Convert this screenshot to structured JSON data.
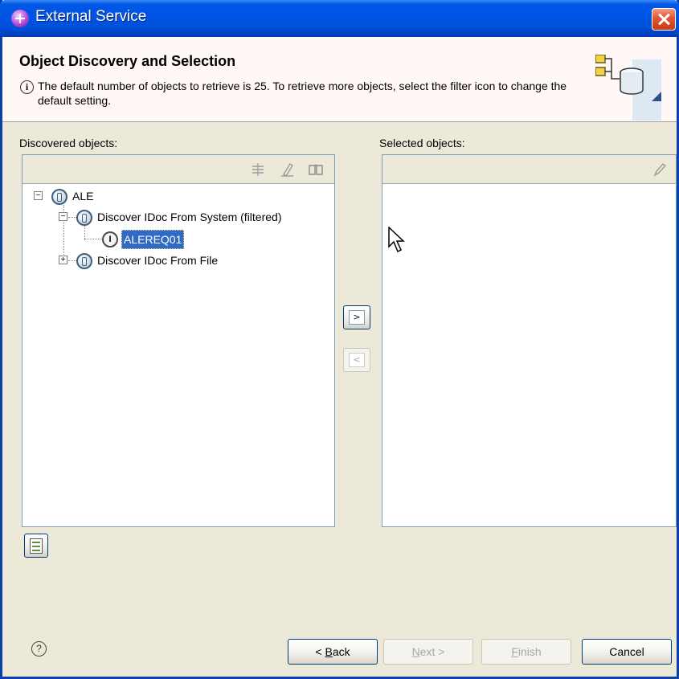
{
  "window": {
    "title": "External Service"
  },
  "header": {
    "title": "Object Discovery and Selection",
    "info_text": "The default number of objects to retrieve is 25.  To retrieve more objects, select the filter icon to change the default setting."
  },
  "discovered": {
    "label": "Discovered objects:",
    "toolbar_icons": [
      "filter-icon",
      "edit-query-icon",
      "book-icon"
    ],
    "tree": {
      "root": {
        "label": "ALE",
        "expanded": true
      },
      "child1": {
        "label": "Discover IDoc From System (filtered)",
        "expanded": true
      },
      "leaf": {
        "label": "ALEREQ01",
        "icon_letter": "I",
        "selected": true
      },
      "child2": {
        "label": "Discover IDoc From File",
        "expanded": false
      }
    }
  },
  "selected": {
    "label": "Selected objects:",
    "toolbar_icons": [
      "edit-icon"
    ]
  },
  "move_buttons": {
    "add": ">",
    "remove": "<"
  },
  "footer": {
    "help": "?",
    "back_label": "Back",
    "back_prefix": "< ",
    "back_mnemonic": "B",
    "back_rest": "ack",
    "next_label": "Next >",
    "next_mnemonic": "N",
    "next_rest": "ext >",
    "finish_label": "Finish",
    "finish_mnemonic": "F",
    "finish_rest": "inish",
    "cancel_label": "Cancel"
  },
  "colors": {
    "titlebar": "#0054E3",
    "selection": "#316AC5",
    "dialog_bg": "#ECE9D8",
    "header_bg": "#FFF8F6"
  }
}
